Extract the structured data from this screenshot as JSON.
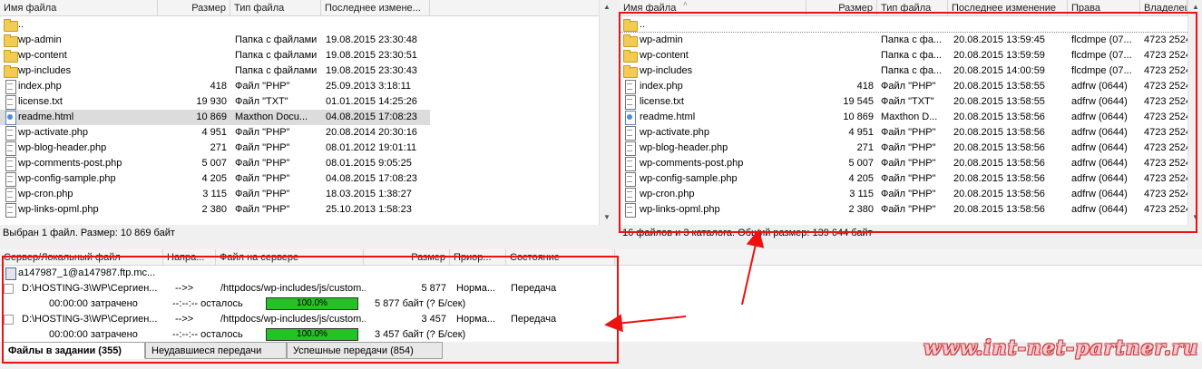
{
  "local": {
    "columns": [
      "Имя файла",
      "Размер",
      "Тип файла",
      "Последнее измене..."
    ],
    "rows": [
      {
        "icon": "folder",
        "name": "..",
        "size": "",
        "type": "",
        "modified": "",
        "selected": false
      },
      {
        "icon": "folder",
        "name": "wp-admin",
        "size": "",
        "type": "Папка с файлами",
        "modified": "19.08.2015 23:30:48",
        "selected": false
      },
      {
        "icon": "folder",
        "name": "wp-content",
        "size": "",
        "type": "Папка с файлами",
        "modified": "19.08.2015 23:30:51",
        "selected": false
      },
      {
        "icon": "folder",
        "name": "wp-includes",
        "size": "",
        "type": "Папка с файлами",
        "modified": "19.08.2015 23:30:43",
        "selected": false
      },
      {
        "icon": "file",
        "name": "index.php",
        "size": "418",
        "type": "Файл \"PHP\"",
        "modified": "25.09.2013 3:18:11",
        "selected": false
      },
      {
        "icon": "file",
        "name": "license.txt",
        "size": "19 930",
        "type": "Файл \"TXT\"",
        "modified": "01.01.2015 14:25:26",
        "selected": false
      },
      {
        "icon": "html",
        "name": "readme.html",
        "size": "10 869",
        "type": "Maxthon Docu...",
        "modified": "04.08.2015 17:08:23",
        "selected": true
      },
      {
        "icon": "file",
        "name": "wp-activate.php",
        "size": "4 951",
        "type": "Файл \"PHP\"",
        "modified": "20.08.2014 20:30:16",
        "selected": false
      },
      {
        "icon": "file",
        "name": "wp-blog-header.php",
        "size": "271",
        "type": "Файл \"PHP\"",
        "modified": "08.01.2012 19:01:11",
        "selected": false
      },
      {
        "icon": "file",
        "name": "wp-comments-post.php",
        "size": "5 007",
        "type": "Файл \"PHP\"",
        "modified": "08.01.2015 9:05:25",
        "selected": false
      },
      {
        "icon": "file",
        "name": "wp-config-sample.php",
        "size": "4 205",
        "type": "Файл \"PHP\"",
        "modified": "04.08.2015 17:08:23",
        "selected": false
      },
      {
        "icon": "file",
        "name": "wp-cron.php",
        "size": "3 115",
        "type": "Файл \"PHP\"",
        "modified": "18.03.2015 1:38:27",
        "selected": false
      },
      {
        "icon": "file",
        "name": "wp-links-opml.php",
        "size": "2 380",
        "type": "Файл \"PHP\"",
        "modified": "25.10.2013 1:58:23",
        "selected": false
      }
    ],
    "status": "Выбран 1 файл. Размер: 10 869 байт"
  },
  "remote": {
    "columns": [
      "Имя файла",
      "Размер",
      "Тип файла",
      "Последнее изменение",
      "Права",
      "Владелец/..."
    ],
    "rows": [
      {
        "icon": "folder",
        "name": "..",
        "size": "",
        "type": "",
        "modified": "",
        "perms": "",
        "owner": ""
      },
      {
        "icon": "folder",
        "name": "wp-admin",
        "size": "",
        "type": "Папка с фа...",
        "modified": "20.08.2015 13:59:45",
        "perms": "flcdmpe (07...",
        "owner": "4723 2524"
      },
      {
        "icon": "folder",
        "name": "wp-content",
        "size": "",
        "type": "Папка с фа...",
        "modified": "20.08.2015 13:59:59",
        "perms": "flcdmpe (07...",
        "owner": "4723 2524"
      },
      {
        "icon": "folder",
        "name": "wp-includes",
        "size": "",
        "type": "Папка с фа...",
        "modified": "20.08.2015 14:00:59",
        "perms": "flcdmpe (07...",
        "owner": "4723 2524"
      },
      {
        "icon": "file",
        "name": "index.php",
        "size": "418",
        "type": "Файл \"PHP\"",
        "modified": "20.08.2015 13:58:55",
        "perms": "adfrw (0644)",
        "owner": "4723 2524"
      },
      {
        "icon": "file",
        "name": "license.txt",
        "size": "19 545",
        "type": "Файл \"TXT\"",
        "modified": "20.08.2015 13:58:55",
        "perms": "adfrw (0644)",
        "owner": "4723 2524"
      },
      {
        "icon": "html",
        "name": "readme.html",
        "size": "10 869",
        "type": "Maxthon D...",
        "modified": "20.08.2015 13:58:56",
        "perms": "adfrw (0644)",
        "owner": "4723 2524"
      },
      {
        "icon": "file",
        "name": "wp-activate.php",
        "size": "4 951",
        "type": "Файл \"PHP\"",
        "modified": "20.08.2015 13:58:56",
        "perms": "adfrw (0644)",
        "owner": "4723 2524"
      },
      {
        "icon": "file",
        "name": "wp-blog-header.php",
        "size": "271",
        "type": "Файл \"PHP\"",
        "modified": "20.08.2015 13:58:56",
        "perms": "adfrw (0644)",
        "owner": "4723 2524"
      },
      {
        "icon": "file",
        "name": "wp-comments-post.php",
        "size": "5 007",
        "type": "Файл \"PHP\"",
        "modified": "20.08.2015 13:58:56",
        "perms": "adfrw (0644)",
        "owner": "4723 2524"
      },
      {
        "icon": "file",
        "name": "wp-config-sample.php",
        "size": "4 205",
        "type": "Файл \"PHP\"",
        "modified": "20.08.2015 13:58:56",
        "perms": "adfrw (0644)",
        "owner": "4723 2524"
      },
      {
        "icon": "file",
        "name": "wp-cron.php",
        "size": "3 115",
        "type": "Файл \"PHP\"",
        "modified": "20.08.2015 13:58:56",
        "perms": "adfrw (0644)",
        "owner": "4723 2524"
      },
      {
        "icon": "file",
        "name": "wp-links-opml.php",
        "size": "2 380",
        "type": "Файл \"PHP\"",
        "modified": "20.08.2015 13:58:56",
        "perms": "adfrw (0644)",
        "owner": "4723 2524"
      }
    ],
    "status": "16 файлов и 3 каталога. Общий размер: 139 644 байт"
  },
  "queue": {
    "columns": [
      "Сервер/Локальный файл",
      "Напра...",
      "Файл на сервере",
      "Размер",
      "Приор...",
      "Состояние"
    ],
    "server": "a147987_1@a147987.ftp.mc...",
    "items": [
      {
        "local": "D:\\HOSTING-3\\WP\\Сергиен...",
        "direction": "-->>",
        "remote": "/httpdocs/wp-includes/js/custom...",
        "size": "5 877",
        "priority": "Норма...",
        "state": "Передача",
        "elapsed": "00:00:00 затрачено",
        "remaining": "--:--:-- осталось",
        "progress": 1.0,
        "progress_label": "100.0%",
        "transferred": "5 877 байт (? Б/сек)"
      },
      {
        "local": "D:\\HOSTING-3\\WP\\Сергиен...",
        "direction": "-->>",
        "remote": "/httpdocs/wp-includes/js/custom...",
        "size": "3 457",
        "priority": "Норма...",
        "state": "Передача",
        "elapsed": "00:00:00 затрачено",
        "remaining": "--:--:-- осталось",
        "progress": 1.0,
        "progress_label": "100.0%",
        "transferred": "3 457 байт (? Б/сек)"
      }
    ]
  },
  "tabs": [
    "Файлы в задании (355)",
    "Неудавшиеся передачи",
    "Успешные передачи (854)"
  ],
  "watermark": "www.int-net-partner.ru",
  "colors": {
    "annotation": "#ee1111",
    "progress": "#24c224",
    "selection": "#dcdcdc"
  }
}
